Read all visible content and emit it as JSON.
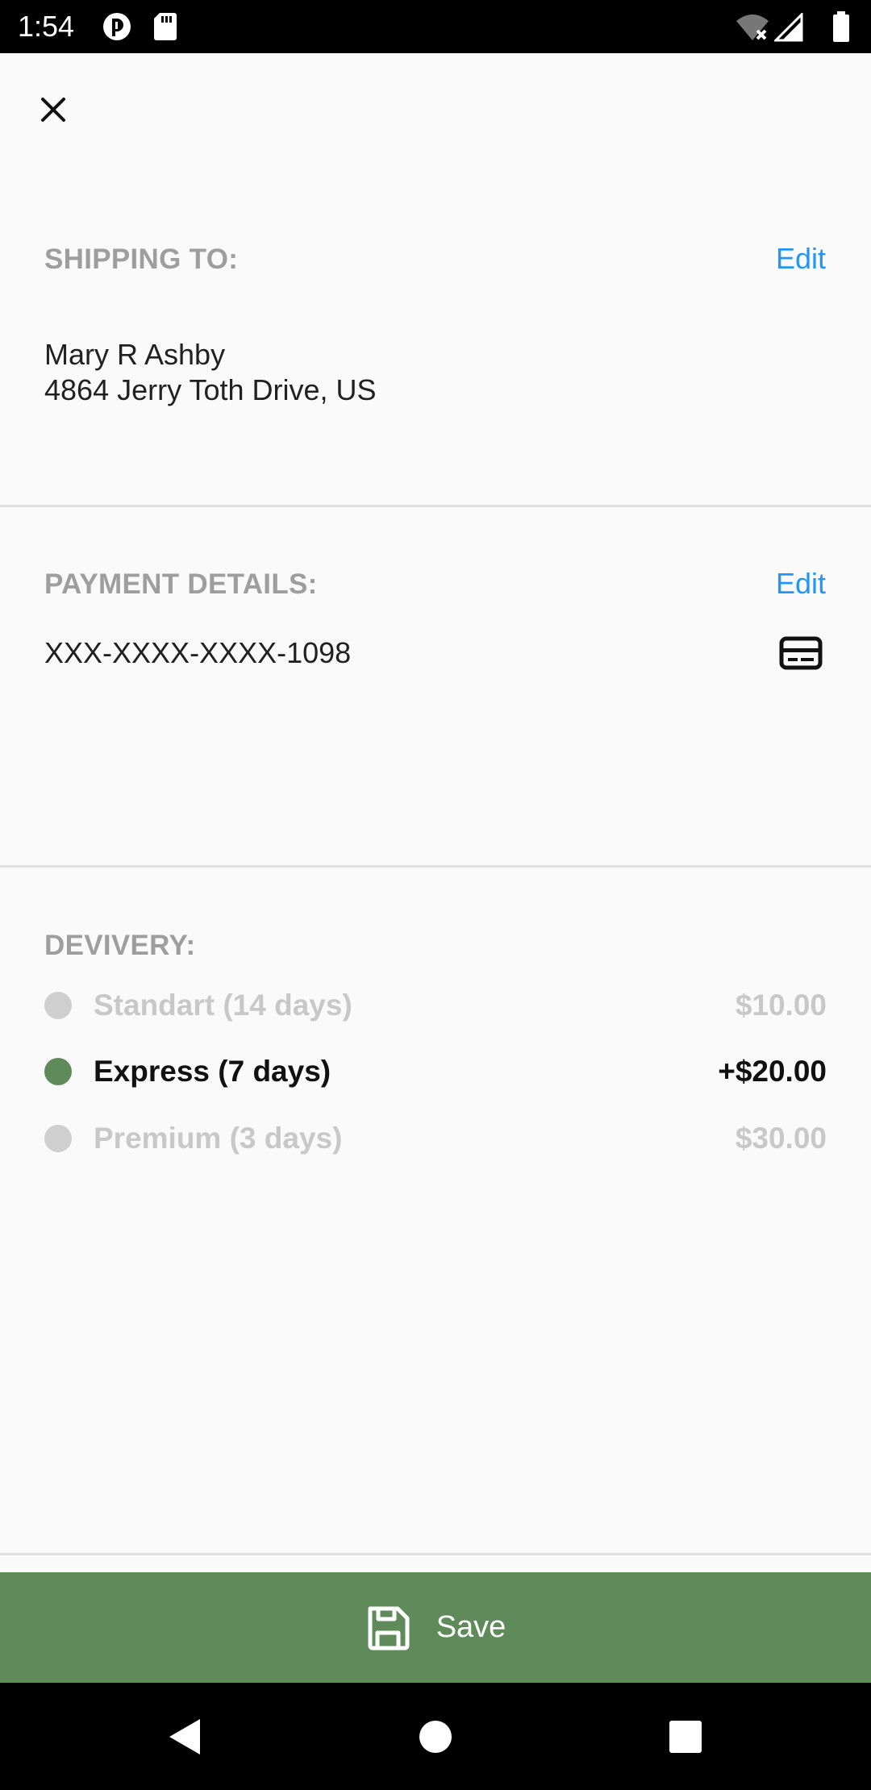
{
  "status_bar": {
    "time": "1:54",
    "icons": [
      "app-notification-icon",
      "sd-card-icon",
      "wifi-off-icon",
      "signal-icon",
      "battery-icon"
    ]
  },
  "header": {
    "close_icon": "close-icon"
  },
  "shipping": {
    "label": "SHIPPING TO:",
    "edit_label": "Edit",
    "name": "Mary R Ashby",
    "address": "4864  Jerry Toth Drive, US"
  },
  "payment": {
    "label": "PAYMENT DETAILS:",
    "edit_label": "Edit",
    "card_number": "XXX-XXXX-XXXX-1098",
    "card_icon": "credit-card-icon"
  },
  "delivery": {
    "label": "DEVIVERY:",
    "options": [
      {
        "name": "Standart (14 days)",
        "price": "$10.00",
        "selected": false
      },
      {
        "name": "Express (7 days)",
        "price": "+$20.00",
        "selected": true
      },
      {
        "name": "Premium (3 days)",
        "price": "$30.00",
        "selected": false
      }
    ]
  },
  "save": {
    "label": "Save",
    "icon": "save-icon"
  },
  "colors": {
    "accent_green": "#5f8b5a",
    "link_blue": "#2196f3",
    "label_grey": "#9e9e9e",
    "disabled_grey": "#c8c8c8"
  },
  "nav_bar": {
    "icons": [
      "back-icon",
      "home-icon",
      "recents-icon"
    ]
  }
}
